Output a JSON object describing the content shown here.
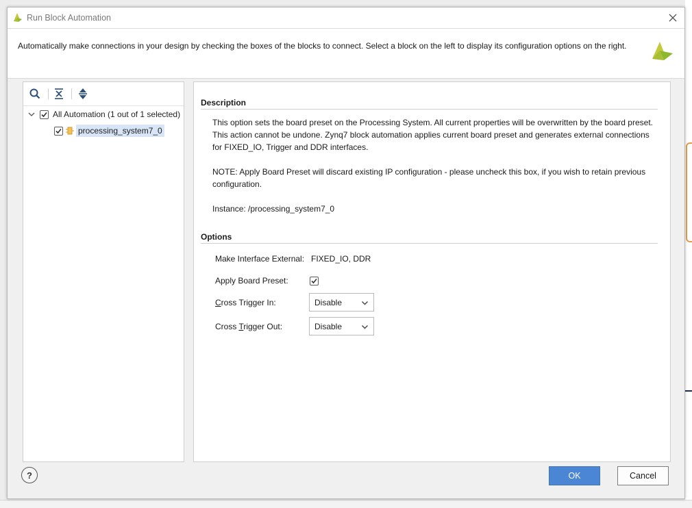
{
  "window": {
    "title": "Run Block Automation"
  },
  "header": {
    "text": "Automatically make connections in your design by checking the boxes of the blocks to connect. Select a block on the left to display its configuration options on the right."
  },
  "tree": {
    "root": {
      "label": "All Automation (1 out of 1 selected)",
      "checked": true,
      "expanded": true
    },
    "children": [
      {
        "label": "processing_system7_0",
        "checked": true,
        "selected": true
      }
    ]
  },
  "description": {
    "title": "Description",
    "para1": "This option sets the board preset on the Processing System. All current properties will be overwritten by the board preset. This action cannot be undone. Zynq7 block automation applies current board preset and generates external connections for FIXED_IO, Trigger and DDR interfaces.",
    "para2": "NOTE: Apply Board Preset will discard existing IP configuration - please uncheck this box, if you wish to retain previous configuration.",
    "instance": "Instance: /processing_system7_0"
  },
  "options": {
    "title": "Options",
    "make_external_label": "Make Interface External:",
    "make_external_value": "FIXED_IO, DDR",
    "apply_preset_label": "Apply Board Preset:",
    "apply_preset_checked": true,
    "cross_trigger_in": {
      "mnemonic": "C",
      "rest": "ross Trigger In:",
      "value": "Disable"
    },
    "cross_trigger_out": {
      "prefix": "Cross ",
      "mnemonic": "T",
      "rest": "rigger Out:",
      "value": "Disable"
    }
  },
  "buttons": {
    "help": "?",
    "ok": "OK",
    "cancel": "Cancel"
  },
  "colors": {
    "ok_button": "#4a86d4",
    "selection": "#d7e5f7",
    "logo_yellow": "#c2c93a",
    "logo_green": "#8bb82d"
  }
}
